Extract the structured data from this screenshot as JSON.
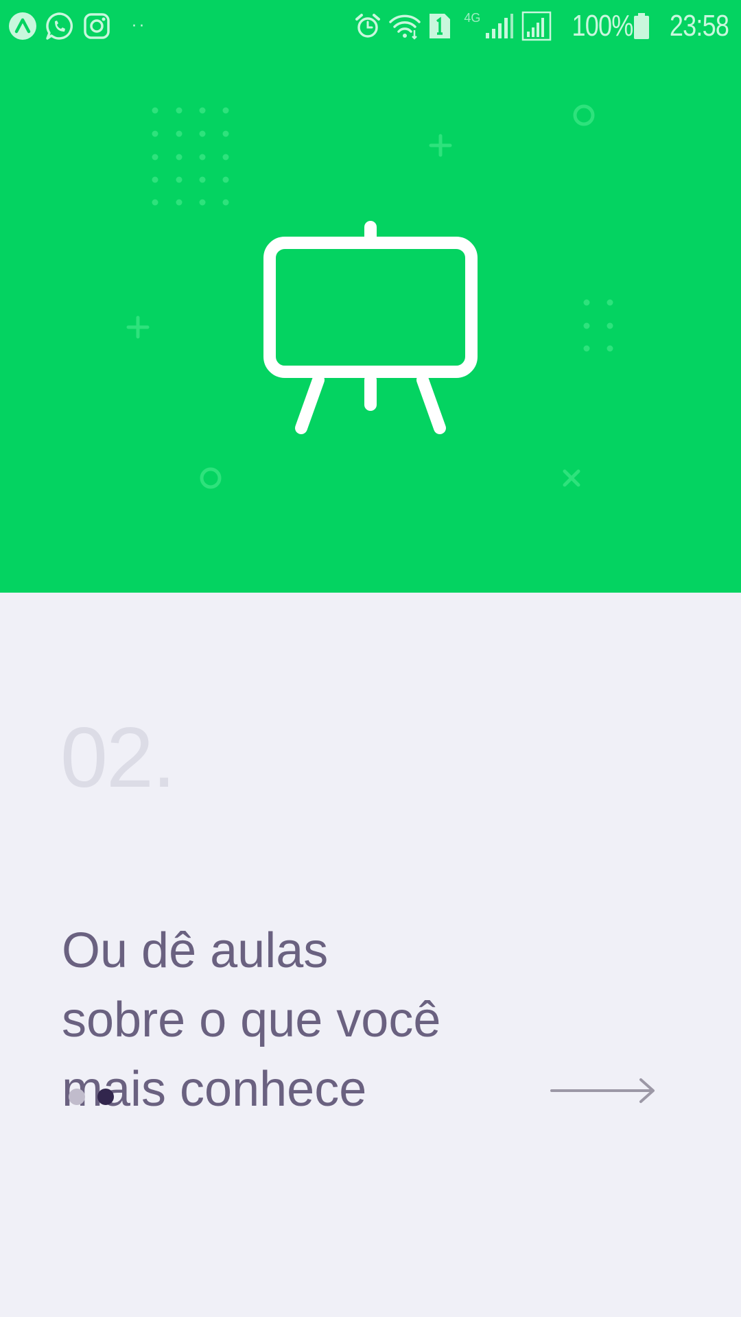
{
  "status_bar": {
    "notification_icons": [
      "android-auto-icon",
      "whatsapp-icon",
      "instagram-icon"
    ],
    "overflow": "··",
    "network_type": "4G",
    "battery": "100%",
    "time": "23:58"
  },
  "colors": {
    "hero_background": "#04d361",
    "page_background": "#f0f0f7",
    "title_text": "#6a6180",
    "number_text": "#dcdce6",
    "dot_active": "#32264d",
    "dot_inactive": "#c1bccc"
  },
  "hero": {
    "icon": "easel-icon"
  },
  "onboarding": {
    "step_number": "02.",
    "title_lines": [
      "Ou dê aulas",
      "sobre o que você",
      "mais conhece"
    ],
    "page_count": 2,
    "current_page": 2,
    "next_icon": "arrow-right-icon"
  }
}
